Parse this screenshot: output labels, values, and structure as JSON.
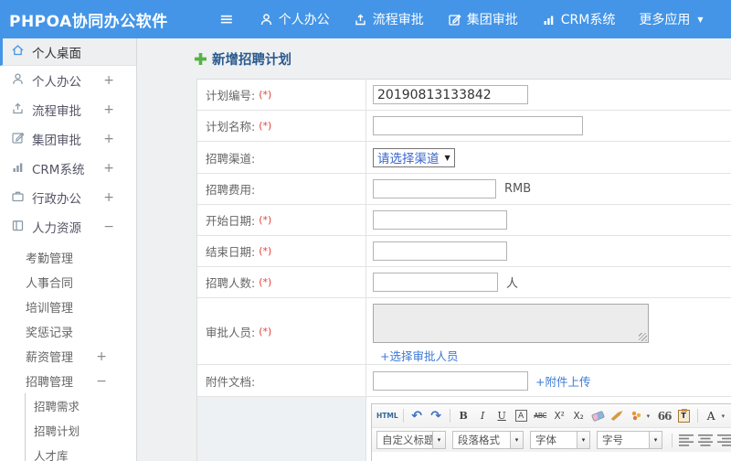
{
  "colors": {
    "topbar_blue": "#4495e7",
    "title_navy": "#2a5a8f",
    "plus_green": "#55b345",
    "required_red": "#e2403a",
    "link_blue": "#3b7ad9",
    "select_text_blue": "#3a66cc"
  },
  "icons": {
    "hamburger": "≡",
    "caret_down": "▼",
    "caret_small": "▾",
    "undo": "↶",
    "redo": "↷",
    "bold": "B",
    "italic": "I",
    "underline": "U",
    "autotypeset": "A",
    "strikethrough": "ABC",
    "superscript": "X²",
    "subscript": "X₂",
    "quote": "66",
    "clipboard_letter": "T",
    "font_color": "A",
    "highlight": "ab",
    "html_source": "HTML"
  },
  "topbar": {
    "brand": "PHPOA协同办公软件",
    "menu": [
      {
        "label": "个人办公",
        "icon": "user-icon"
      },
      {
        "label": "流程审批",
        "icon": "workflow-icon"
      },
      {
        "label": "集团审批",
        "icon": "edit-square-icon"
      },
      {
        "label": "CRM系统",
        "icon": "bar-chart-icon"
      },
      {
        "label": "更多应用",
        "icon": "caret-down-icon"
      }
    ]
  },
  "sidebar": {
    "items": [
      {
        "label": "个人桌面",
        "icon": "home-icon",
        "active": true
      },
      {
        "label": "个人办公",
        "icon": "user-icon",
        "expand": "+"
      },
      {
        "label": "流程审批",
        "icon": "workflow-icon",
        "expand": "+"
      },
      {
        "label": "集团审批",
        "icon": "edit-square-icon",
        "expand": "+"
      },
      {
        "label": "CRM系统",
        "icon": "bar-chart-icon",
        "expand": "+"
      },
      {
        "label": "行政办公",
        "icon": "briefcase-icon",
        "expand": "+"
      },
      {
        "label": "人力资源",
        "icon": "hr-book-icon",
        "expand": "−"
      }
    ],
    "hr_children": [
      {
        "label": "考勤管理"
      },
      {
        "label": "人事合同"
      },
      {
        "label": "培训管理"
      },
      {
        "label": "奖惩记录"
      },
      {
        "label": "薪资管理",
        "expand": "+"
      },
      {
        "label": "招聘管理",
        "expand": "−"
      }
    ],
    "recruit_children": [
      {
        "label": "招聘需求"
      },
      {
        "label": "招聘计划"
      },
      {
        "label": "人才库"
      }
    ]
  },
  "form": {
    "title": "新增招聘计划",
    "required_mark": "(*)",
    "rows": {
      "plan_no": {
        "label": "计划编号:",
        "value": "20190813133842"
      },
      "plan_name": {
        "label": "计划名称:"
      },
      "channel": {
        "label": "招聘渠道:",
        "selected": "请选择渠道"
      },
      "fee": {
        "label": "招聘费用:",
        "suffix": "RMB"
      },
      "start_date": {
        "label": "开始日期:"
      },
      "end_date": {
        "label": "结束日期:"
      },
      "headcount": {
        "label": "招聘人数:",
        "suffix": "人"
      },
      "approvers": {
        "label": "审批人员:",
        "link": "+选择审批人员"
      },
      "attachment": {
        "label": "附件文档:",
        "link": "+附件上传"
      }
    }
  },
  "editor": {
    "dropdowns": [
      "自定义标题",
      "段落格式",
      "字体",
      "字号"
    ]
  }
}
